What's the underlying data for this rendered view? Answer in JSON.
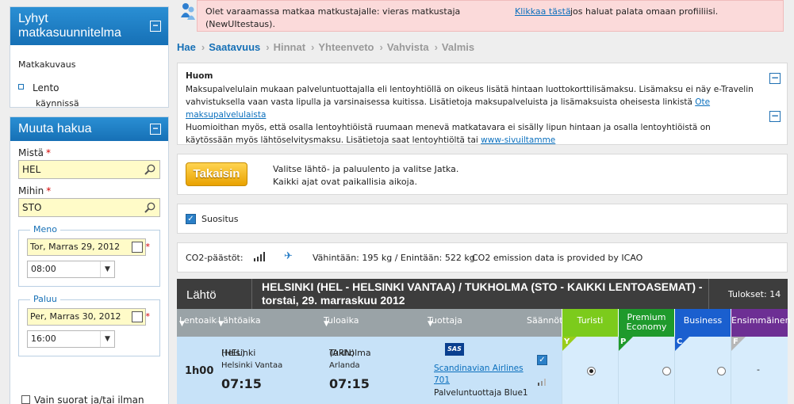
{
  "sidebar": {
    "itinerary": {
      "title": "Lyhyt matkasuunnitelma",
      "description_label": "Matkakuvaus",
      "item_label": "Lento",
      "item_status": "käynnissä"
    },
    "search": {
      "title": "Muuta hakua",
      "from_label": "Mistä",
      "from_value": "HEL",
      "to_label": "Mihin",
      "to_value": "STO",
      "outbound_legend": "Meno",
      "outbound_date": "Tor, Marras 29, 2012",
      "outbound_time": "08:00",
      "return_legend": "Paluu",
      "return_date": "Per, Marras 30, 2012",
      "return_time": "16:00",
      "direct_label": "Vain suorat ja/tai ilman"
    }
  },
  "notice": {
    "line1": "Olet varaamassa matkaa matkustajalle: vieras matkustaja",
    "line2": "(NewUItestaus).",
    "link": "Klikkaa tästä",
    "link_suffix": "jos haluat palata omaan profiiliisi."
  },
  "breadcrumb": [
    "Hae",
    "Saatavuus",
    "Hinnat",
    "Yhteenveto",
    "Vahvista",
    "Valmis"
  ],
  "huom": {
    "title": "Huom",
    "p1": "Maksupalvelulain mukaan palveluntuottajalla eli lentoyhtiöllä on oikeus lisätä hintaan luottokorttilisämaksu. Lisämaksu ei näy e-Travelin vahvistuksella vaan vasta lipulla ja varsinaisessa kuitissa. Lisätietoja maksupalveluista ja lisämaksuista oheisesta linkistä",
    "p1_link": "Ote maksupalvelulaista",
    "p2": "Huomioithan myös, että osalla lentoyhtiöistä ruumaan menevä matkatavara ei sisälly lipun hintaan ja osalla lentoyhtiöistä on käytössään myös lähtöselvitysmaksu. Lisätietoja saat lentoyhtiöltä tai",
    "p2_link": "www-sivuiltamme"
  },
  "back": {
    "button": "Takaisin",
    "line1": "Valitse lähtö- ja paluulento ja valitse Jatka.",
    "line2": "Kaikki ajat ovat paikallisia aikoja."
  },
  "suositus": "Suositus",
  "co2": {
    "label": "CO2-päästöt:",
    "range": "Vähintään: 195 kg / Enintään: 522 kg",
    "source": "CO2 emission data is provided by ICAO"
  },
  "results": {
    "direction": "Lähtö",
    "route": "HELSINKI (HEL - HELSINKI VANTAA) / TUKHOLMA (STO - KAIKKI LENTOASEMAT) - torstai, 29. marraskuu 2012",
    "count": "Tulokset: 14",
    "columns": {
      "duration": "Lentoaika",
      "depart": "Lähtöaika",
      "arrive": "Tuloaika",
      "carrier": "Tuottaja",
      "rules": "Säännöt"
    },
    "classes": [
      {
        "name": "Turisti",
        "letter": "Y",
        "color": "#7ccb1c",
        "tri": "#54a40a"
      },
      {
        "name": "Premium Economy",
        "letter": "P",
        "color": "#1f9a2c",
        "tri": "#0f7a1c"
      },
      {
        "name": "Business",
        "letter": "C",
        "color": "#1a5fcf",
        "tri": "#1048a8"
      },
      {
        "name": "Ensimmäinen",
        "letter": "F",
        "color": "#6d2f94",
        "tri": "#b7b7b7"
      }
    ],
    "flight": {
      "duration": "1h00",
      "from_city": "Helsinki",
      "from_code": "(HEL)",
      "from_airport": "Helsinki Vantaa",
      "depart_time": "07:15",
      "to_city": "Tukholma",
      "to_code": "(ARN)",
      "to_airport": "Arlanda",
      "arrive_time": "07:15",
      "airline_logo": "SAS",
      "airline": "Scandinavian Airlines",
      "flight_no": "701",
      "operator": "Palveluntuottaja Blue1",
      "first_class": "-"
    }
  }
}
